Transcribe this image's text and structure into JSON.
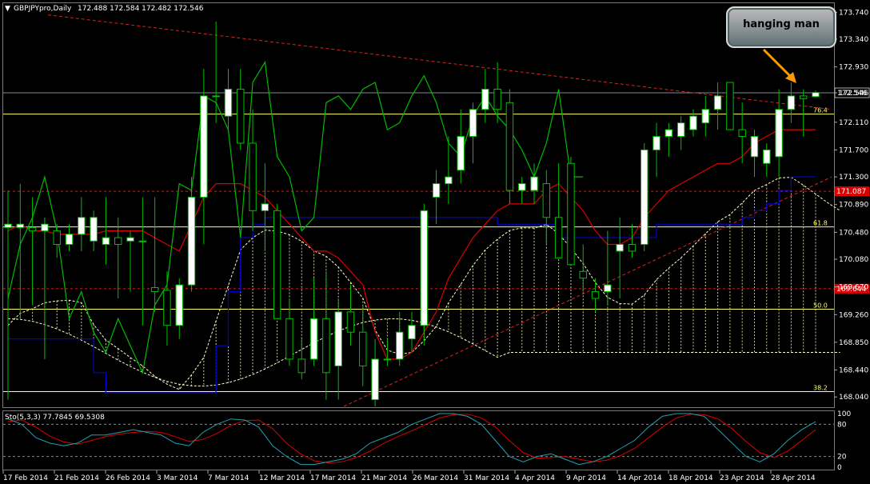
{
  "window": {
    "title": "GBPJPYpro,Daily",
    "ohlc": "172.488 172.584 172.482 172.546",
    "callout_text": "hanging man"
  },
  "colors": {
    "background": "#000000",
    "grid": "#3a3a3a",
    "bull_candle": "#ffffff",
    "bear_candle_border": "#00b000",
    "ichimoku_tenkan": "#dd0000",
    "ichimoku_kijun": "#0000dd",
    "chikou": "#00bb00",
    "kumo": "#ffffcc",
    "fib": "#ffff66",
    "trendline": "#dd2222",
    "stoch_main": "#22a0b0",
    "stoch_signal": "#dd0000"
  },
  "price_axis": {
    "ticks": [
      "173.740",
      "173.340",
      "172.930",
      "172.546",
      "172.110",
      "171.700",
      "171.300",
      "170.890",
      "170.480",
      "170.080",
      "169.670",
      "169.260",
      "168.850",
      "168.440",
      "168.040"
    ],
    "current_price": "172.546",
    "red_level_1": "171.087",
    "red_level_2": "169.644"
  },
  "fib_levels": [
    {
      "label": "76.4",
      "price": 172.23
    },
    {
      "label": "61.8",
      "price": 170.56
    },
    {
      "label": "50.0",
      "price": 169.34
    },
    {
      "label": "38.2",
      "price": 168.12
    }
  ],
  "date_axis": [
    "17 Feb 2014",
    "21 Feb 2014",
    "26 Feb 2014",
    "3 Mar 2014",
    "7 Mar 2014",
    "12 Mar 2014",
    "17 Mar 2014",
    "21 Mar 2014",
    "26 Mar 2014",
    "31 Mar 2014",
    "4 Apr 2014",
    "9 Apr 2014",
    "14 Apr 2014",
    "18 Apr 2014",
    "23 Apr 2014",
    "28 Apr 2014"
  ],
  "stoch": {
    "title": "Sto(5,3,3) 77.7845 69.5308",
    "ticks": [
      "100",
      "80",
      "20",
      "0"
    ]
  },
  "chart_data": {
    "type": "candlestick",
    "title": "GBPJPYpro,Daily",
    "ylim": [
      167.9,
      173.85
    ],
    "candles": [
      {
        "o": 170.55,
        "h": 171.1,
        "l": 168.0,
        "c": 170.6
      },
      {
        "o": 170.55,
        "h": 171.2,
        "l": 169.2,
        "c": 170.6
      },
      {
        "o": 170.55,
        "h": 171.0,
        "l": 169.4,
        "c": 170.5
      },
      {
        "o": 170.5,
        "h": 170.7,
        "l": 168.6,
        "c": 170.6
      },
      {
        "o": 170.5,
        "h": 170.6,
        "l": 170.1,
        "c": 170.3
      },
      {
        "o": 170.3,
        "h": 170.6,
        "l": 170.2,
        "c": 170.45
      },
      {
        "o": 170.45,
        "h": 171.0,
        "l": 170.2,
        "c": 170.7
      },
      {
        "o": 170.35,
        "h": 170.8,
        "l": 170.2,
        "c": 170.7
      },
      {
        "o": 170.3,
        "h": 171.0,
        "l": 170.0,
        "c": 170.4
      },
      {
        "o": 170.4,
        "h": 170.7,
        "l": 169.5,
        "c": 170.3
      },
      {
        "o": 170.35,
        "h": 170.5,
        "l": 169.6,
        "c": 170.4
      },
      {
        "o": 170.35,
        "h": 171.0,
        "l": 169.1,
        "c": 170.35
      },
      {
        "o": 169.66,
        "h": 171.0,
        "l": 169.3,
        "c": 169.6
      },
      {
        "o": 169.62,
        "h": 169.9,
        "l": 168.8,
        "c": 169.1
      },
      {
        "o": 169.1,
        "h": 169.8,
        "l": 168.9,
        "c": 169.7
      },
      {
        "o": 169.7,
        "h": 171.3,
        "l": 169.6,
        "c": 171.0
      },
      {
        "o": 171.0,
        "h": 172.9,
        "l": 170.3,
        "c": 172.5
      },
      {
        "o": 172.5,
        "h": 173.6,
        "l": 172.1,
        "c": 172.5
      },
      {
        "o": 172.2,
        "h": 172.9,
        "l": 172.0,
        "c": 172.6
      },
      {
        "o": 172.6,
        "h": 172.9,
        "l": 171.7,
        "c": 171.8
      },
      {
        "o": 171.8,
        "h": 172.3,
        "l": 170.5,
        "c": 170.8
      },
      {
        "o": 170.8,
        "h": 171.5,
        "l": 170.2,
        "c": 170.9
      },
      {
        "o": 170.8,
        "h": 170.9,
        "l": 169.3,
        "c": 169.2
      },
      {
        "o": 169.2,
        "h": 169.5,
        "l": 168.5,
        "c": 168.6
      },
      {
        "o": 168.6,
        "h": 168.9,
        "l": 168.3,
        "c": 168.4
      },
      {
        "o": 168.6,
        "h": 169.8,
        "l": 168.5,
        "c": 169.2
      },
      {
        "o": 169.2,
        "h": 169.9,
        "l": 168.0,
        "c": 168.4
      },
      {
        "o": 168.5,
        "h": 169.5,
        "l": 168.0,
        "c": 169.3
      },
      {
        "o": 169.3,
        "h": 169.7,
        "l": 168.8,
        "c": 169.0
      },
      {
        "o": 169.0,
        "h": 169.4,
        "l": 168.2,
        "c": 168.5
      },
      {
        "o": 168.0,
        "h": 168.9,
        "l": 167.9,
        "c": 168.6
      },
      {
        "o": 168.6,
        "h": 168.9,
        "l": 168.5,
        "c": 168.6
      },
      {
        "o": 168.6,
        "h": 169.3,
        "l": 168.5,
        "c": 169.0
      },
      {
        "o": 168.9,
        "h": 169.3,
        "l": 168.7,
        "c": 169.1
      },
      {
        "o": 169.1,
        "h": 170.9,
        "l": 168.8,
        "c": 170.8
      },
      {
        "o": 171.0,
        "h": 171.4,
        "l": 170.6,
        "c": 171.2
      },
      {
        "o": 171.2,
        "h": 171.9,
        "l": 170.9,
        "c": 171.3
      },
      {
        "o": 171.4,
        "h": 172.3,
        "l": 171.2,
        "c": 171.9
      },
      {
        "o": 171.9,
        "h": 172.4,
        "l": 171.5,
        "c": 172.3
      },
      {
        "o": 172.3,
        "h": 172.9,
        "l": 172.1,
        "c": 172.6
      },
      {
        "o": 172.6,
        "h": 173.0,
        "l": 172.1,
        "c": 172.3
      },
      {
        "o": 172.4,
        "h": 172.6,
        "l": 170.9,
        "c": 171.1
      },
      {
        "o": 171.1,
        "h": 171.3,
        "l": 170.9,
        "c": 171.2
      },
      {
        "o": 171.1,
        "h": 171.5,
        "l": 170.9,
        "c": 171.3
      },
      {
        "o": 171.2,
        "h": 171.4,
        "l": 170.3,
        "c": 170.7
      },
      {
        "o": 170.7,
        "h": 171.5,
        "l": 170.1,
        "c": 170.1
      },
      {
        "o": 171.5,
        "h": 171.6,
        "l": 170.0,
        "c": 170.0
      },
      {
        "o": 169.9,
        "h": 170.3,
        "l": 169.6,
        "c": 169.8
      },
      {
        "o": 169.6,
        "h": 169.8,
        "l": 169.3,
        "c": 169.5
      },
      {
        "o": 169.6,
        "h": 170.5,
        "l": 169.4,
        "c": 169.7
      },
      {
        "o": 170.2,
        "h": 170.7,
        "l": 169.5,
        "c": 170.3
      },
      {
        "o": 170.3,
        "h": 170.6,
        "l": 170.1,
        "c": 170.2
      },
      {
        "o": 170.3,
        "h": 171.8,
        "l": 170.2,
        "c": 171.7
      },
      {
        "o": 171.7,
        "h": 172.1,
        "l": 171.3,
        "c": 171.9
      },
      {
        "o": 171.9,
        "h": 172.1,
        "l": 171.6,
        "c": 172.0
      },
      {
        "o": 171.9,
        "h": 172.2,
        "l": 171.7,
        "c": 172.1
      },
      {
        "o": 172.0,
        "h": 172.3,
        "l": 171.9,
        "c": 172.2
      },
      {
        "o": 172.1,
        "h": 172.5,
        "l": 171.9,
        "c": 172.3
      },
      {
        "o": 172.3,
        "h": 172.7,
        "l": 172.0,
        "c": 172.5
      },
      {
        "o": 172.7,
        "h": 172.7,
        "l": 172.0,
        "c": 172.0
      },
      {
        "o": 172.0,
        "h": 172.4,
        "l": 171.5,
        "c": 171.9
      },
      {
        "o": 171.6,
        "h": 172.0,
        "l": 171.3,
        "c": 171.9
      },
      {
        "o": 171.5,
        "h": 171.8,
        "l": 171.3,
        "c": 171.7
      },
      {
        "o": 171.6,
        "h": 172.6,
        "l": 171.3,
        "c": 172.3
      },
      {
        "o": 172.3,
        "h": 172.7,
        "l": 172.1,
        "c": 172.5
      },
      {
        "o": 172.5,
        "h": 172.6,
        "l": 171.9,
        "c": 172.46
      },
      {
        "o": 172.49,
        "h": 172.58,
        "l": 172.48,
        "c": 172.55
      }
    ],
    "tenkan": [
      170.5,
      170.6,
      170.5,
      170.5,
      170.45,
      170.45,
      170.45,
      170.45,
      170.5,
      170.5,
      170.5,
      170.5,
      170.4,
      170.3,
      170.2,
      170.6,
      171.0,
      171.2,
      171.2,
      171.2,
      171.1,
      171.0,
      170.8,
      170.6,
      170.4,
      170.2,
      170.2,
      170.1,
      169.9,
      169.7,
      169.0,
      168.6,
      168.6,
      168.7,
      169.0,
      169.3,
      169.8,
      170.1,
      170.4,
      170.6,
      170.8,
      170.9,
      170.9,
      170.9,
      171.1,
      171.2,
      171.0,
      170.8,
      170.5,
      170.3,
      170.3,
      170.4,
      170.7,
      170.9,
      171.1,
      171.2,
      171.3,
      171.4,
      171.5,
      171.5,
      171.6,
      171.8,
      171.9,
      172.0,
      172.0,
      172.0,
      172.0
    ],
    "kijun": [
      168.9,
      168.9,
      168.9,
      168.9,
      168.9,
      168.9,
      168.9,
      168.4,
      168.1,
      168.1,
      168.1,
      168.1,
      168.1,
      168.1,
      168.1,
      168.1,
      168.1,
      168.8,
      169.6,
      170.4,
      170.6,
      170.7,
      170.7,
      170.7,
      170.7,
      170.7,
      170.7,
      170.7,
      170.7,
      170.7,
      170.7,
      170.7,
      170.7,
      170.7,
      170.7,
      170.7,
      170.7,
      170.7,
      170.7,
      170.7,
      170.6,
      170.6,
      170.6,
      170.6,
      170.6,
      170.4,
      170.4,
      170.4,
      170.4,
      170.4,
      170.4,
      170.4,
      170.4,
      170.6,
      170.6,
      170.6,
      170.6,
      170.6,
      170.6,
      170.6,
      170.7,
      170.8,
      170.9,
      171.1,
      171.3,
      171.3,
      171.3
    ],
    "chikou": [
      169.5,
      170.3,
      170.7,
      171.3,
      170.5,
      169.2,
      169.6,
      169.0,
      168.7,
      169.2,
      168.8,
      168.4,
      169.4,
      169.7,
      171.2,
      171.1,
      172.5,
      172.4,
      172.0,
      170.4,
      172.7,
      173.0,
      171.6,
      171.3,
      170.5,
      170.7,
      172.4,
      172.5,
      172.3,
      172.6,
      172.7,
      172.0,
      172.1,
      172.5,
      172.8,
      172.4,
      171.8,
      171.6,
      172.2,
      172.5,
      172.2,
      172.0,
      171.7,
      171.3,
      171.8,
      172.6,
      171.3,
      171.3
    ],
    "stoch_main": [
      90,
      80,
      55,
      45,
      40,
      45,
      60,
      60,
      65,
      70,
      65,
      60,
      45,
      40,
      65,
      80,
      90,
      88,
      75,
      40,
      20,
      5,
      5,
      10,
      15,
      25,
      45,
      55,
      65,
      80,
      90,
      100,
      100,
      95,
      80,
      50,
      20,
      10,
      20,
      25,
      15,
      5,
      10,
      20,
      35,
      50,
      75,
      95,
      100,
      100,
      95,
      70,
      45,
      20,
      10,
      25,
      50,
      70,
      85
    ],
    "stoch_signal": [
      85,
      88,
      75,
      58,
      47,
      43,
      50,
      57,
      62,
      65,
      67,
      65,
      57,
      48,
      52,
      63,
      78,
      87,
      88,
      72,
      45,
      25,
      12,
      8,
      10,
      18,
      30,
      45,
      57,
      68,
      80,
      92,
      98,
      99,
      92,
      75,
      50,
      27,
      17,
      18,
      20,
      15,
      10,
      13,
      22,
      35,
      55,
      75,
      92,
      99,
      98,
      90,
      72,
      48,
      27,
      18,
      30,
      50,
      70
    ]
  }
}
